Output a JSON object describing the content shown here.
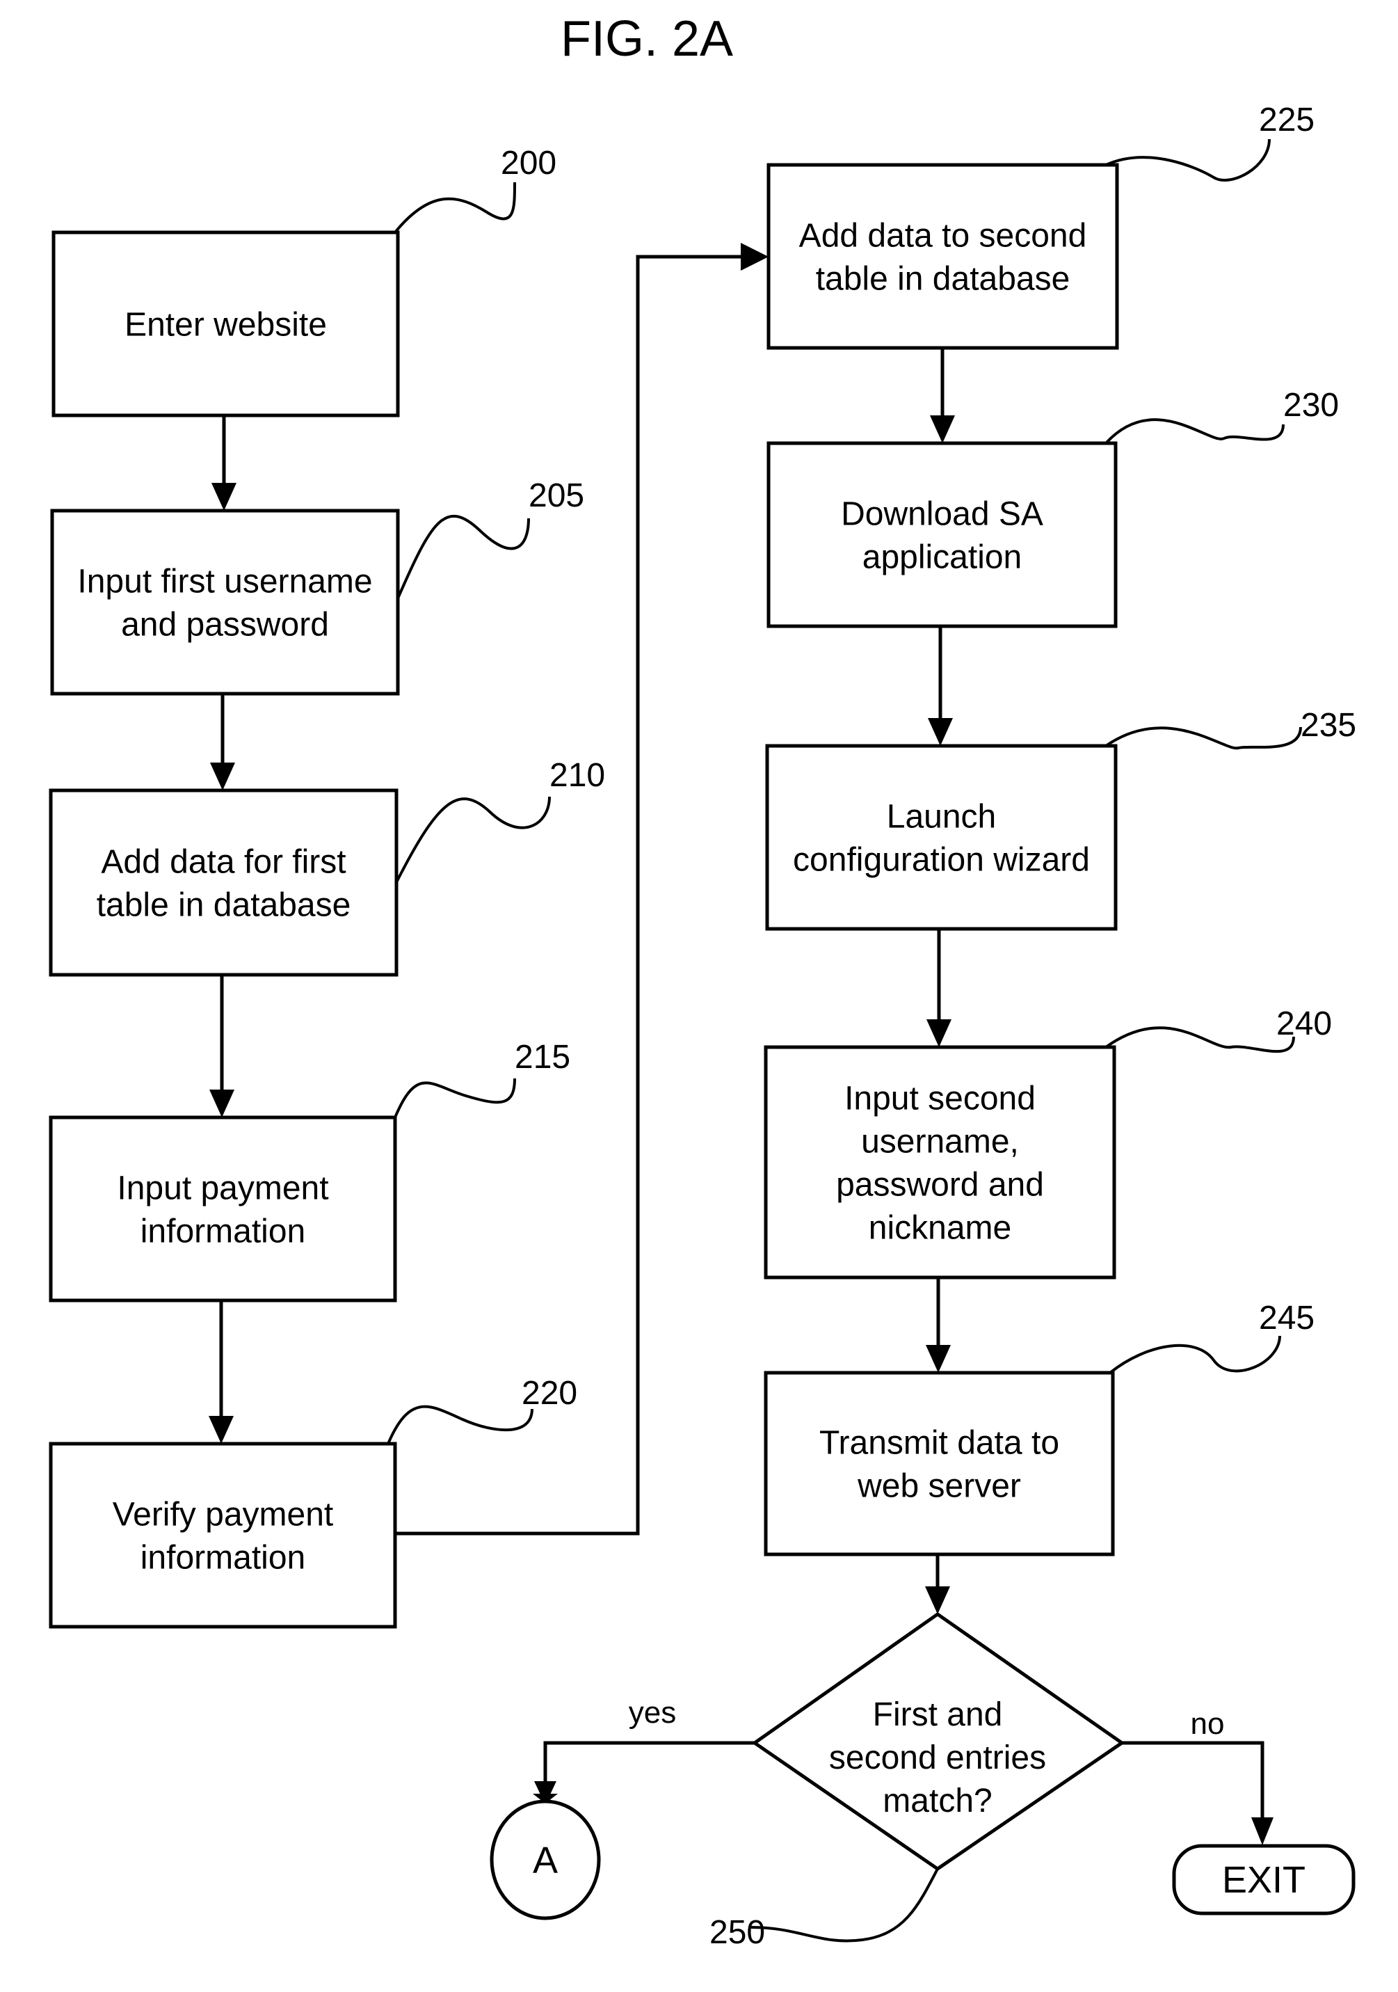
{
  "figure": {
    "title": "FIG. 2A"
  },
  "steps": [
    {
      "ref": "200",
      "lines": [
        "Enter website"
      ]
    },
    {
      "ref": "205",
      "lines": [
        "Input first username",
        "and password"
      ]
    },
    {
      "ref": "210",
      "lines": [
        "Add data for first",
        "table in database"
      ]
    },
    {
      "ref": "215",
      "lines": [
        "Input payment",
        "information"
      ]
    },
    {
      "ref": "220",
      "lines": [
        "Verify payment",
        "information"
      ]
    },
    {
      "ref": "225",
      "lines": [
        "Add data to second",
        "table in database"
      ]
    },
    {
      "ref": "230",
      "lines": [
        "Download SA",
        "application"
      ]
    },
    {
      "ref": "235",
      "lines": [
        "Launch",
        "configuration wizard"
      ]
    },
    {
      "ref": "240",
      "lines": [
        "Input second",
        "username,",
        "password and",
        "nickname"
      ]
    },
    {
      "ref": "245",
      "lines": [
        "Transmit data to",
        "web server"
      ]
    }
  ],
  "decision": {
    "ref": "250",
    "lines": [
      "First and",
      "second entries",
      "match?"
    ],
    "yes_label": "yes",
    "no_label": "no"
  },
  "connector": {
    "label": "A"
  },
  "terminal": {
    "label": "EXIT"
  }
}
